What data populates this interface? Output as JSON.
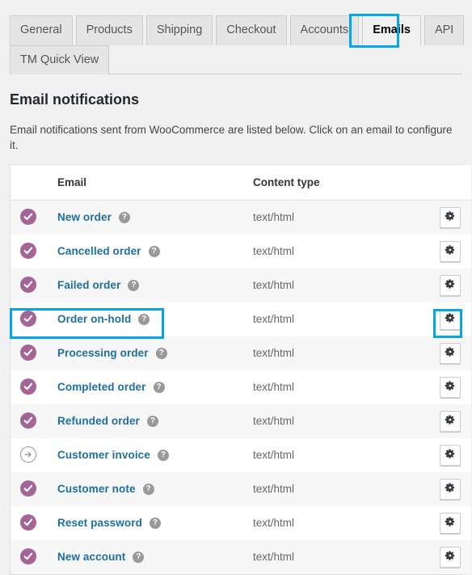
{
  "tabs": {
    "row1": [
      {
        "label": "General",
        "active": false
      },
      {
        "label": "Products",
        "active": false
      },
      {
        "label": "Shipping",
        "active": false
      },
      {
        "label": "Checkout",
        "active": false
      },
      {
        "label": "Accounts",
        "active": false
      },
      {
        "label": "Emails",
        "active": true
      },
      {
        "label": "API",
        "active": false
      }
    ],
    "row2": [
      {
        "label": "TM Quick View",
        "active": false
      }
    ]
  },
  "header": {
    "title": "Email notifications",
    "description": "Email notifications sent from WooCommerce are listed below. Click on an email to configure it."
  },
  "table": {
    "columns": {
      "status": "",
      "email": "Email",
      "content_type": "Content type",
      "action": ""
    },
    "rows": [
      {
        "name": "New order",
        "enabled": true,
        "status_icon": "check-circle-icon",
        "help_icon": "help-icon",
        "content_type": "text/html",
        "action_icon": "gear-icon",
        "highlighted": false
      },
      {
        "name": "Cancelled order",
        "enabled": true,
        "status_icon": "check-circle-icon",
        "help_icon": "help-icon",
        "content_type": "text/html",
        "action_icon": "gear-icon",
        "highlighted": false
      },
      {
        "name": "Failed order",
        "enabled": true,
        "status_icon": "check-circle-icon",
        "help_icon": "help-icon",
        "content_type": "text/html",
        "action_icon": "gear-icon",
        "highlighted": false
      },
      {
        "name": "Order on-hold",
        "enabled": true,
        "status_icon": "check-circle-icon",
        "help_icon": "help-icon",
        "content_type": "text/html",
        "action_icon": "gear-icon",
        "highlighted": false
      },
      {
        "name": "Processing order",
        "enabled": true,
        "status_icon": "check-circle-icon",
        "help_icon": "help-icon",
        "content_type": "text/html",
        "action_icon": "gear-icon",
        "highlighted": true
      },
      {
        "name": "Completed order",
        "enabled": true,
        "status_icon": "check-circle-icon",
        "help_icon": "help-icon",
        "content_type": "text/html",
        "action_icon": "gear-icon",
        "highlighted": false
      },
      {
        "name": "Refunded order",
        "enabled": true,
        "status_icon": "check-circle-icon",
        "help_icon": "help-icon",
        "content_type": "text/html",
        "action_icon": "gear-icon",
        "highlighted": false
      },
      {
        "name": "Customer invoice",
        "enabled": false,
        "status_icon": "arrow-right-circle-icon",
        "help_icon": "help-icon",
        "content_type": "text/html",
        "action_icon": "gear-icon",
        "highlighted": false
      },
      {
        "name": "Customer note",
        "enabled": true,
        "status_icon": "check-circle-icon",
        "help_icon": "help-icon",
        "content_type": "text/html",
        "action_icon": "gear-icon",
        "highlighted": false
      },
      {
        "name": "Reset password",
        "enabled": true,
        "status_icon": "check-circle-icon",
        "help_icon": "help-icon",
        "content_type": "text/html",
        "action_icon": "gear-icon",
        "highlighted": false
      },
      {
        "name": "New account",
        "enabled": true,
        "status_icon": "check-circle-icon",
        "help_icon": "help-icon",
        "content_type": "text/html",
        "action_icon": "gear-icon",
        "highlighted": false
      }
    ]
  },
  "help_glyph": "?",
  "colors": {
    "highlight": "#06a7e8",
    "status_enabled": "#a46497",
    "status_disabled": "#999999",
    "link": "#1d6fa3",
    "page_bg": "#f1f1f1",
    "row_odd": "#f7f7f7",
    "row_even": "#ffffff"
  }
}
